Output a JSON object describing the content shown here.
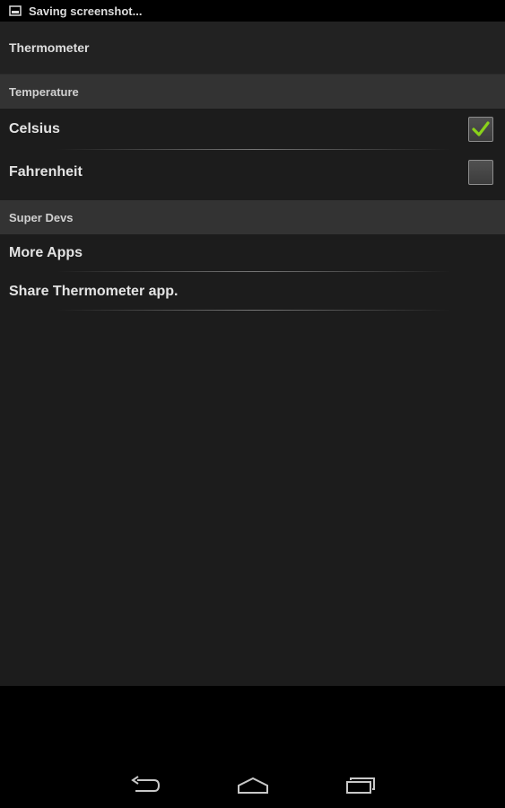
{
  "status_bar": {
    "notification_text": "Saving screenshot..."
  },
  "app": {
    "title": "Thermometer"
  },
  "sections": [
    {
      "header": "Temperature",
      "items": [
        {
          "label": "Celsius",
          "checked": true
        },
        {
          "label": "Fahrenheit",
          "checked": false
        }
      ]
    },
    {
      "header": "Super Devs",
      "items": [
        {
          "label": "More Apps"
        },
        {
          "label": "Share Thermometer app."
        }
      ]
    }
  ],
  "navigation": {
    "back": "back-icon",
    "home": "home-icon",
    "recents": "recents-icon"
  },
  "colors": {
    "check_accent": "#8ad21a",
    "section_header_bg": "#333333",
    "app_bg": "#1c1c1c"
  }
}
